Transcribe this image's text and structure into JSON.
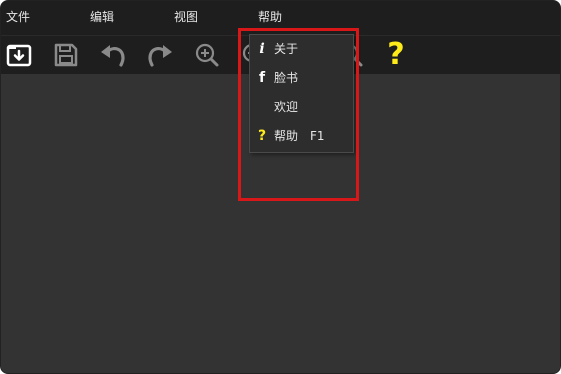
{
  "menubar": {
    "items": [
      {
        "label": "文件"
      },
      {
        "label": "编辑"
      },
      {
        "label": "视图"
      },
      {
        "label": "帮助"
      }
    ]
  },
  "toolbar": {
    "buttons": [
      {
        "icon": "download-folder-icon"
      },
      {
        "icon": "save-icon"
      },
      {
        "icon": "undo-icon"
      },
      {
        "icon": "redo-icon"
      },
      {
        "icon": "zoom-in-icon"
      },
      {
        "icon": "zoom-out-icon"
      },
      {
        "icon": "zoom-fit-icon"
      },
      {
        "icon": "help-icon",
        "glyph": "?"
      }
    ]
  },
  "help_menu": {
    "items": [
      {
        "icon": "info-icon",
        "glyph": "i",
        "label": "关于",
        "shortcut": ""
      },
      {
        "icon": "facebook-icon",
        "glyph": "f",
        "label": "脸书",
        "shortcut": ""
      },
      {
        "icon": "",
        "glyph": "",
        "label": "欢迎",
        "shortcut": ""
      },
      {
        "icon": "help-icon",
        "glyph": "?",
        "label": "帮助",
        "shortcut": "F1"
      }
    ]
  },
  "colors": {
    "bar_background": "#1e1e1e",
    "canvas_background": "#333333",
    "help_accent": "#ffeb1a",
    "highlight_border": "#d81818"
  }
}
